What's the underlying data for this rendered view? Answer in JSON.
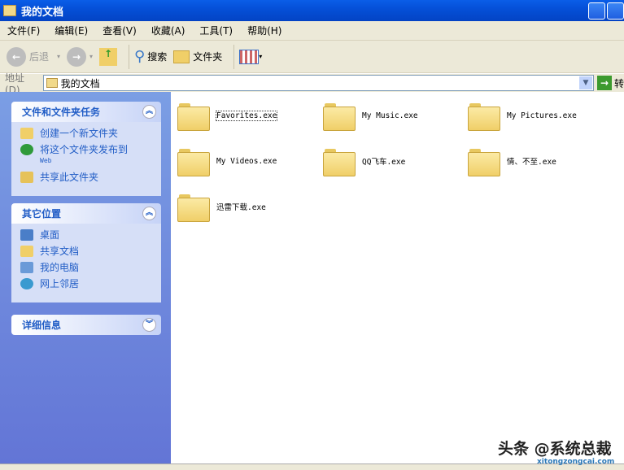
{
  "window": {
    "title": "我的文档"
  },
  "menu": [
    "文件(F)",
    "编辑(E)",
    "查看(V)",
    "收藏(A)",
    "工具(T)",
    "帮助(H)"
  ],
  "toolbar": {
    "back": "后退",
    "search": "搜索",
    "folders": "文件夹"
  },
  "address": {
    "label": "地址(D)",
    "value": "我的文档",
    "go": "转"
  },
  "tasks": {
    "title": "文件和文件夹任务",
    "items": [
      "创建一个新文件夹",
      "将这个文件夹发布到",
      "共享此文件夹"
    ],
    "web": "Web"
  },
  "places": {
    "title": "其它位置",
    "items": [
      "桌面",
      "共享文档",
      "我的电脑",
      "网上邻居"
    ]
  },
  "details": {
    "title": "详细信息"
  },
  "files": [
    "Favorites.exe",
    "My Music.exe",
    "My Pictures.exe",
    "My Videos.exe",
    "QQ飞车.exe",
    "情、不至.exe",
    "迅雷下载.exe"
  ],
  "watermark": {
    "text": "头条 @系统总裁",
    "url": "xitongzongcai.com"
  }
}
